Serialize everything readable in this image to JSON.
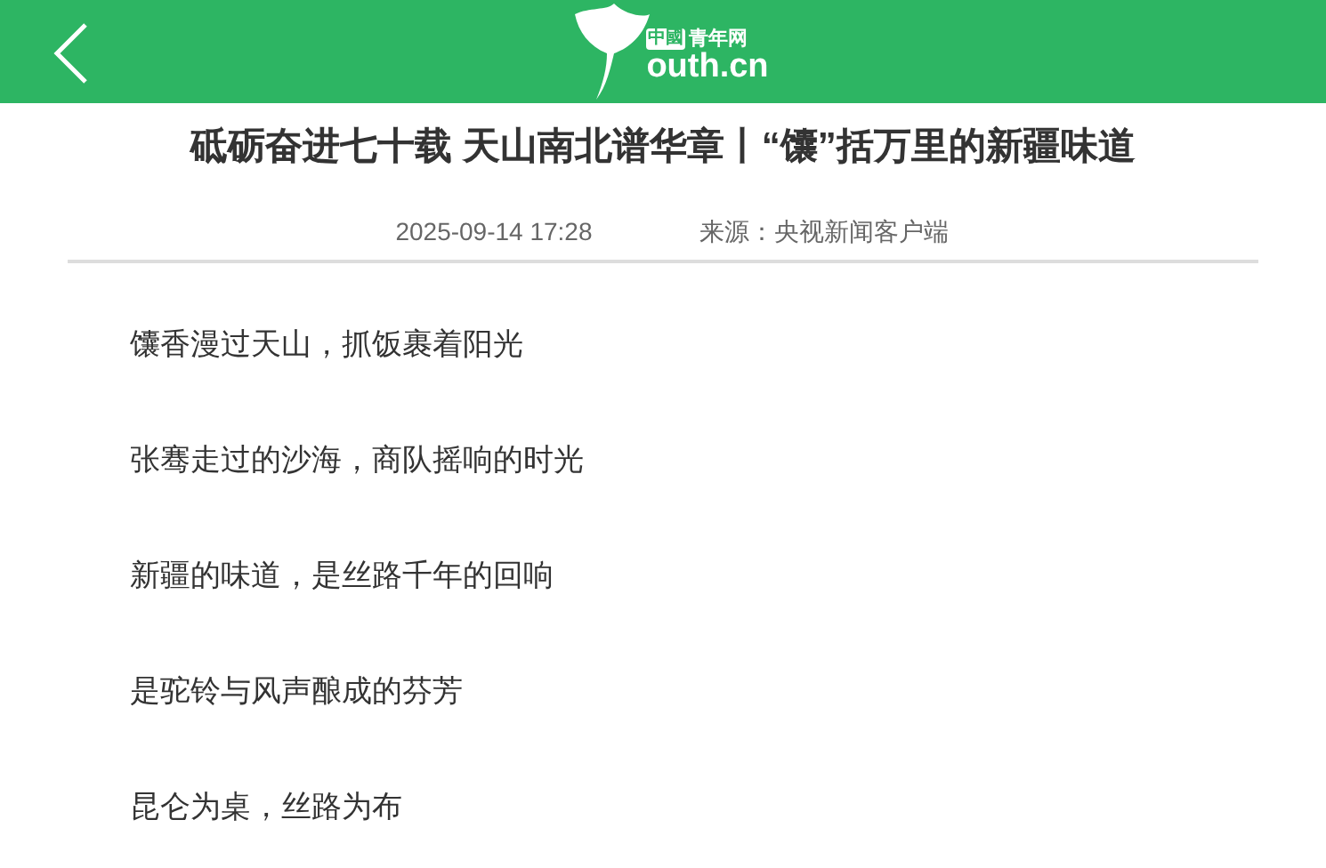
{
  "header": {
    "logo": {
      "badge": "中國",
      "name": "青年网",
      "domain": "outh.cn"
    }
  },
  "article": {
    "title": "砥砺奋进七十载 天山南北谱华章丨“馕”括万里的新疆味道",
    "date": "2025-09-14 17:28",
    "source": "来源：央视新闻客户端",
    "paragraphs": [
      "馕香漫过天山，抓饭裹着阳光",
      "张骞走过的沙海，商队摇响的时光",
      "新疆的味道，是丝路千年的回响",
      "是驼铃与风声酿成的芬芳",
      "昆仑为桌，丝路为布"
    ]
  }
}
